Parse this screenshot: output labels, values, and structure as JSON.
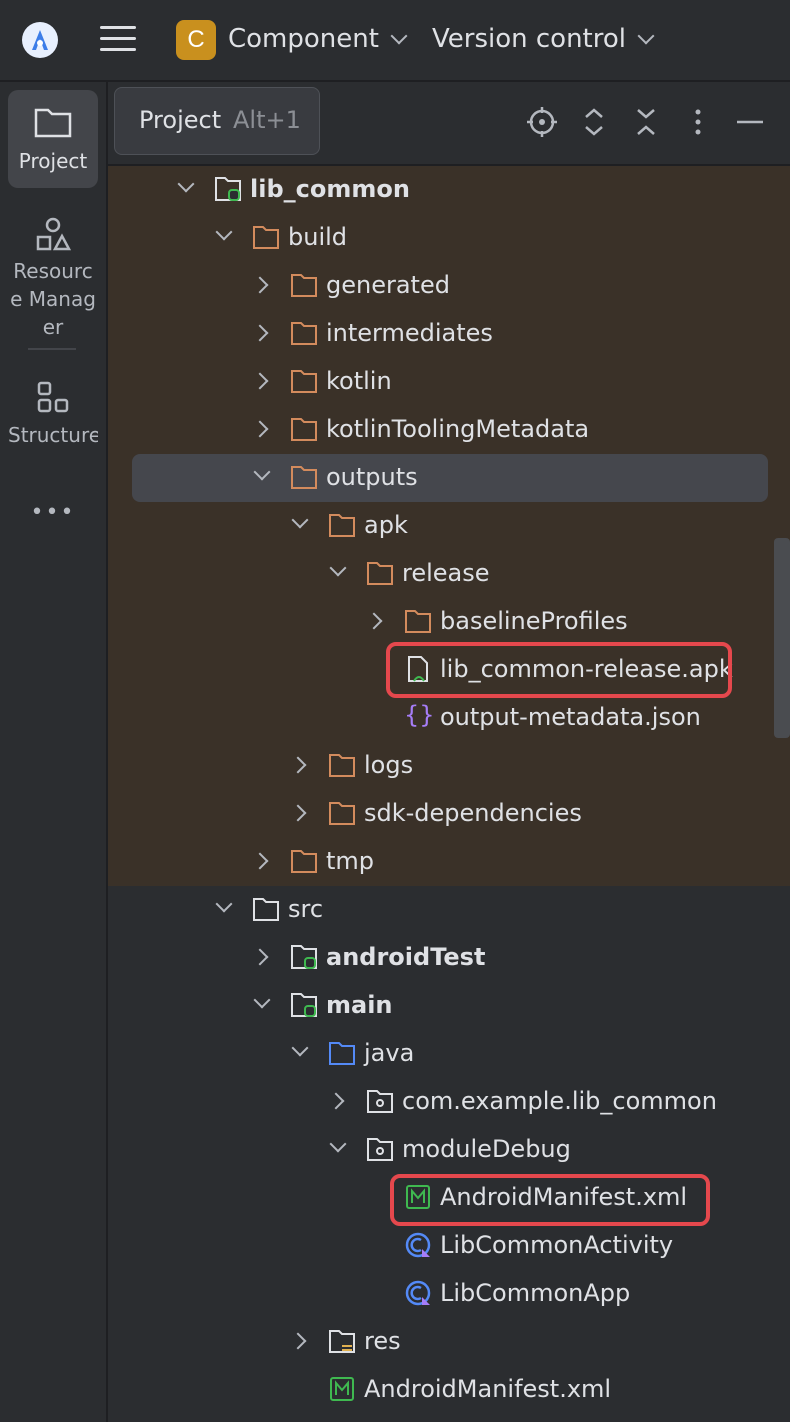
{
  "topbar": {
    "project_initial": "C",
    "project_name": "Component",
    "version_control": "Version control"
  },
  "toolstrip": {
    "items": [
      {
        "label": "Project"
      },
      {
        "label": "Resource Manager"
      },
      {
        "label": "Structure"
      }
    ],
    "more": "•••"
  },
  "panel": {
    "tab_title": "Project",
    "tab_shortcut": "Alt+1"
  },
  "tree": {
    "rows": [
      {
        "label": "lib_common"
      },
      {
        "label": "build"
      },
      {
        "label": "generated"
      },
      {
        "label": "intermediates"
      },
      {
        "label": "kotlin"
      },
      {
        "label": "kotlinToolingMetadata"
      },
      {
        "label": "outputs"
      },
      {
        "label": "apk"
      },
      {
        "label": "release"
      },
      {
        "label": "baselineProfiles"
      },
      {
        "label": "lib_common-release.apk"
      },
      {
        "label": "output-metadata.json"
      },
      {
        "label": "logs"
      },
      {
        "label": "sdk-dependencies"
      },
      {
        "label": "tmp"
      },
      {
        "label": "src"
      },
      {
        "label": "androidTest"
      },
      {
        "label": "main"
      },
      {
        "label": "java"
      },
      {
        "label": "com.example.lib_common"
      },
      {
        "label": "moduleDebug"
      },
      {
        "label": "AndroidManifest.xml"
      },
      {
        "label": "LibCommonActivity"
      },
      {
        "label": "LibCommonApp"
      },
      {
        "label": "res"
      },
      {
        "label": "AndroidManifest.xml"
      }
    ]
  },
  "colors": {
    "background": "#2b2d30",
    "build_highlight": "#3a3128",
    "selection": "#45474d",
    "folder_excluded": "#d38b5d",
    "module_green": "#3fb950",
    "source_blue": "#548af7",
    "callout_red": "#e5484d"
  }
}
